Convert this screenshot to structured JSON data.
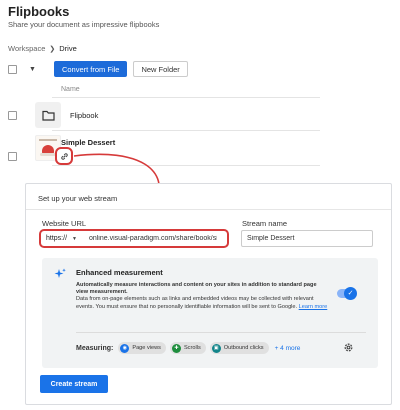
{
  "app": {
    "title": "Flipbooks",
    "subtitle": "Share your document as impressive flipbooks"
  },
  "breadcrumb": {
    "items": [
      "Workspace",
      "Drive"
    ]
  },
  "toolbar": {
    "convert_label": "Convert from File",
    "new_folder_label": "New Folder"
  },
  "list": {
    "column_name": "Name",
    "rows": [
      {
        "title": "Flipbook",
        "icon": "folder-icon"
      },
      {
        "title": "Simple Dessert",
        "icon": "link-icon"
      }
    ]
  },
  "stream_setup": {
    "header": "Set up your web stream",
    "website_url_label": "Website URL",
    "protocol": "https://",
    "url_value": "online.visual-paradigm.com/share/book/simpl",
    "stream_name_label": "Stream name",
    "stream_name_value": "Simple Dessert",
    "enhanced": {
      "title": "Enhanced measurement",
      "desc_bold": "Automatically measure interactions and content on your sites in addition to standard page view measurement.",
      "desc": "Data from on-page elements such as links and embedded videos may be collected with relevant events. You must ensure that no personally identifiable information will be sent to Google.",
      "learn_more": "Learn more",
      "toggle_on": true,
      "measuring_label": "Measuring:",
      "chips": [
        "Page views",
        "Scrolls",
        "Outbound clicks"
      ],
      "more": "+ 4 more"
    },
    "create_label": "Create stream"
  },
  "colors": {
    "primary": "#1d6bd9",
    "google_blue": "#1a73e8",
    "highlight_red": "#d63a3a",
    "chip_green": "#1e8e3e",
    "chip_teal": "#12858a"
  }
}
